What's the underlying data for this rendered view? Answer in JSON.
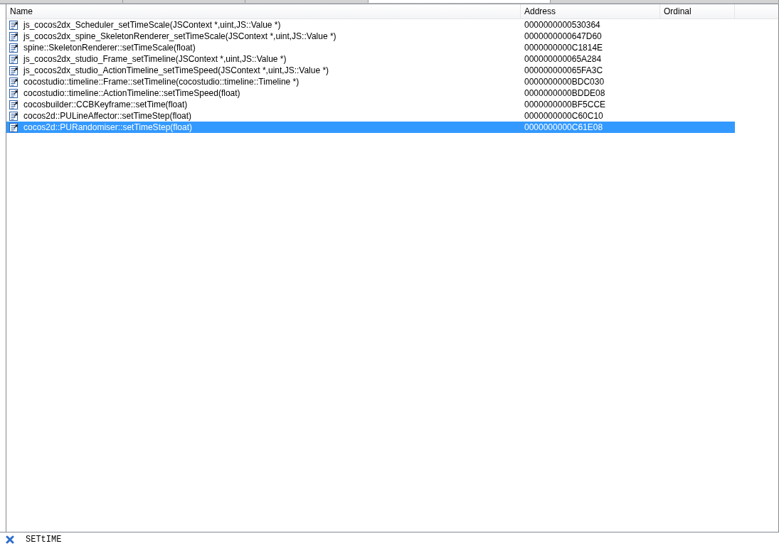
{
  "table": {
    "columns": [
      "Name",
      "Address",
      "Ordinal"
    ],
    "rows": [
      {
        "name": "js_cocos2dx_Scheduler_setTimeScale(JSContext *,uint,JS::Value *)",
        "address": "0000000000530364",
        "selected": false
      },
      {
        "name": "js_cocos2dx_spine_SkeletonRenderer_setTimeScale(JSContext *,uint,JS::Value *)",
        "address": "0000000000647D60",
        "selected": false
      },
      {
        "name": "spine::SkeletonRenderer::setTimeScale(float)",
        "address": "0000000000C1814E",
        "selected": false
      },
      {
        "name": "js_cocos2dx_studio_Frame_setTimeline(JSContext *,uint,JS::Value *)",
        "address": "000000000065A284",
        "selected": false
      },
      {
        "name": "js_cocos2dx_studio_ActionTimeline_setTimeSpeed(JSContext *,uint,JS::Value *)",
        "address": "000000000065FA3C",
        "selected": false
      },
      {
        "name": "cocostudio::timeline::Frame::setTimeline(cocostudio::timeline::Timeline *)",
        "address": "0000000000BDC030",
        "selected": false
      },
      {
        "name": "cocostudio::timeline::ActionTimeline::setTimeSpeed(float)",
        "address": "0000000000BDDE08",
        "selected": false
      },
      {
        "name": "cocosbuilder::CCBKeyframe::setTime(float)",
        "address": "0000000000BF5CCE",
        "selected": false
      },
      {
        "name": "cocos2d::PULineAffector::setTimeStep(float)",
        "address": "0000000000C60C10",
        "selected": false
      },
      {
        "name": "cocos2d::PURandomiser::setTimeStep(float)",
        "address": "0000000000C61E08",
        "selected": true
      }
    ]
  },
  "status_bar": {
    "search_text": "SETtIME"
  }
}
